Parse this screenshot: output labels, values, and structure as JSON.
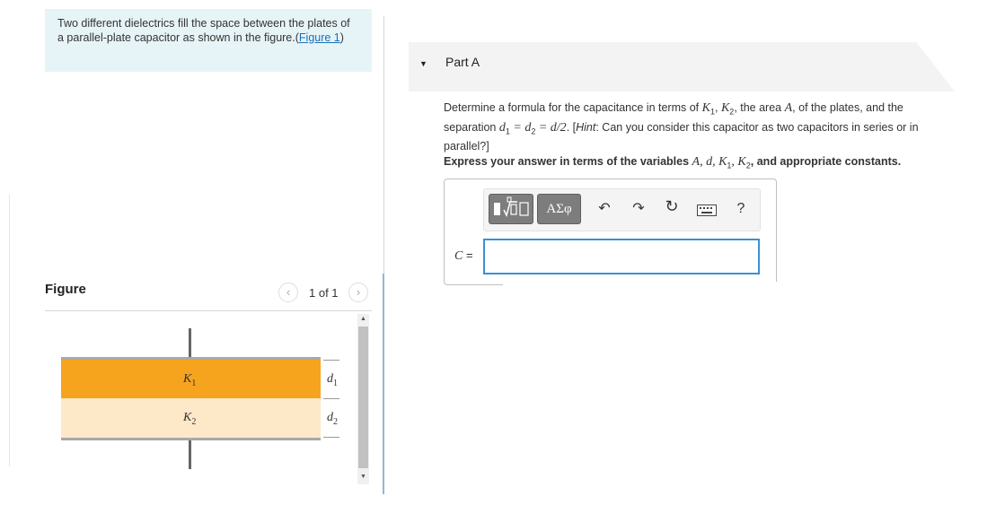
{
  "intro": {
    "text": "Two different dielectrics fill the space between the plates of a parallel-plate capacitor as shown in the figure.",
    "link_open": "(",
    "link": "Figure 1",
    "link_close": ")"
  },
  "figure": {
    "title": "Figure",
    "pager": "1 of 1",
    "prev_icon": "chevron-left-icon",
    "next_icon": "chevron-right-icon",
    "k1": "K",
    "k1_sub": "1",
    "k2": "K",
    "k2_sub": "2",
    "d1": "d",
    "d1_sub": "1",
    "d2": "d",
    "d2_sub": "2",
    "colors": {
      "k1": "#f6a31e",
      "k2": "#fde8c8"
    }
  },
  "part": {
    "title": "Part A",
    "question_pre": "Determine a formula for the capacitance in terms of ",
    "q_K1": "K",
    "q_K1_sub": "1",
    "q_sep1": ", ",
    "q_K2": "K",
    "q_K2_sub": "2",
    "q_mid": ", the area ",
    "q_A": "A",
    "q_post1": ", of the plates, and the separation ",
    "q_eq": "d",
    "q_eq_sub1": "1",
    "q_eq_mid": " = d",
    "q_eq_sub2": "2",
    "q_eq_end": " = d/2",
    "q_dot": ". [",
    "q_hint": "Hint",
    "q_hint_rest": ": Can you consider this capacitor as two capacitors in series or in parallel?]",
    "express_pre": "Express your answer in terms of the variables ",
    "express_vars": "A, d, K",
    "express_sub1": "1",
    "express_mid": ", K",
    "express_sub2": "2",
    "express_post": ", and appropriate constants."
  },
  "answer": {
    "label": "C",
    "equals": " =",
    "greek_button": "ΑΣφ",
    "help": "?",
    "value": ""
  },
  "toolbar_icons": [
    "templates-icon",
    "greek-symbols-icon",
    "undo-icon",
    "redo-icon",
    "reset-icon",
    "keyboard-icon",
    "help-icon"
  ]
}
